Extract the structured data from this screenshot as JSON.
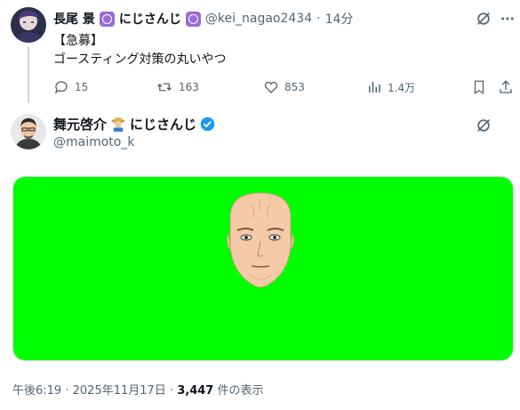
{
  "tweet1": {
    "author_name": "長尾 景",
    "author_tag": "にじさんじ",
    "handle": "@kei_nagao2434",
    "separator": "·",
    "time_ago": "14分",
    "text": "【急募】\nゴースティング対策の丸いやつ",
    "stats": {
      "replies": "15",
      "retweets": "163",
      "likes": "853",
      "views": "1.4万"
    },
    "icons": [
      "grok-icon",
      "more-icon",
      "reply-icon",
      "retweet-icon",
      "like-icon",
      "views-icon",
      "bookmark-icon",
      "share-icon"
    ]
  },
  "tweet2": {
    "author_name": "舞元啓介",
    "author_tag": "にじさんじ",
    "handle": "@maimoto_k",
    "media_background": "#00ff00",
    "icons": [
      "grok-icon",
      "verified-badge-icon",
      "farmer-emoji-icon"
    ]
  },
  "footer": {
    "time": "午後6:19",
    "sep1": "·",
    "date": "2025年11月17日",
    "sep2": "·",
    "views_count": "3,447",
    "views_suffix": "件の表示"
  },
  "colors": {
    "text_primary": "#0f1419",
    "text_secondary": "#536471",
    "verified_blue": "#1d9bf0",
    "nijisanji_purple": "#9b6bd6",
    "green_screen": "#00ff00"
  }
}
